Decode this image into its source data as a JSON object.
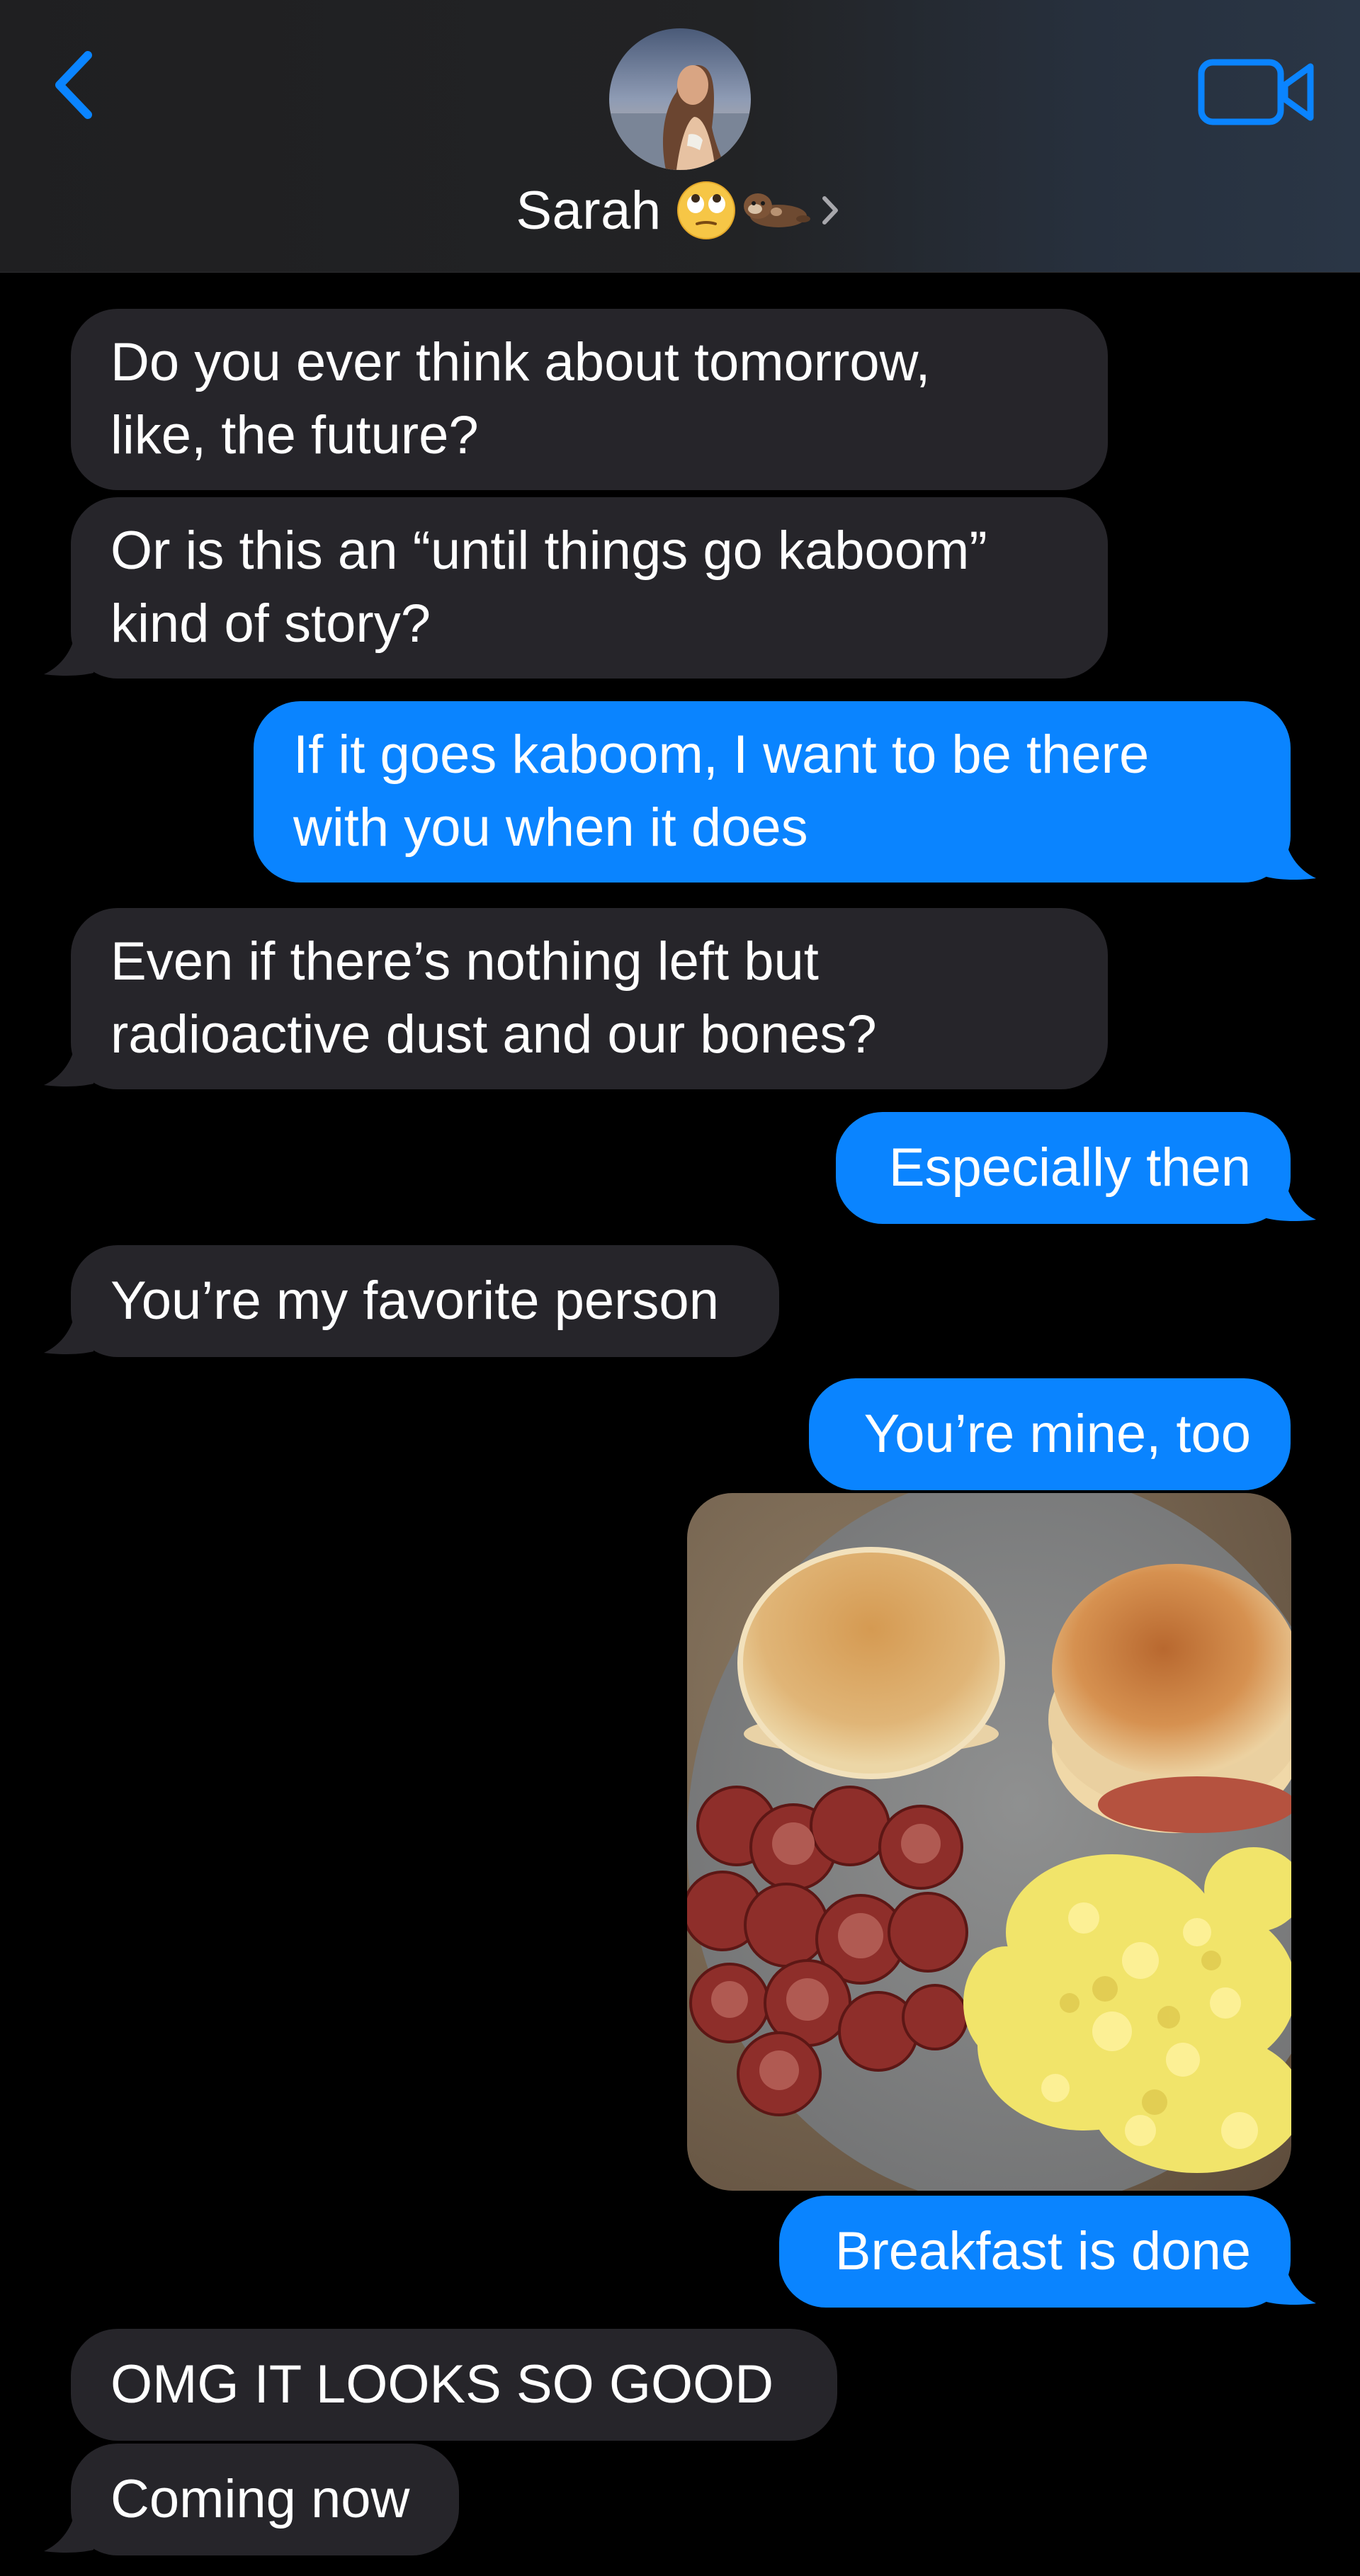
{
  "header": {
    "contact_name": "Sarah",
    "icons": {
      "back": "chevron-left-icon",
      "video": "video-camera-icon",
      "emoji1": "face-with-rolling-eyes-icon",
      "emoji2": "otter-icon",
      "disclosure": "chevron-right-icon"
    }
  },
  "colors": {
    "incoming_bubble": "#26252a",
    "outgoing_bubble": "#0a84ff",
    "accent": "#0a84ff",
    "background": "#000000"
  },
  "messages": [
    {
      "from": "them",
      "text": "Do you ever think about tomorrow,\nlike, the future?"
    },
    {
      "from": "them",
      "text": "Or is this an “until things go kaboom”\nkind of story?"
    },
    {
      "from": "me",
      "text": "If it goes kaboom, I want to be there\nwith you when it does"
    },
    {
      "from": "them",
      "text": "Even if there’s nothing left but\nradioactive dust and our bones?"
    },
    {
      "from": "me",
      "text": "Especially then"
    },
    {
      "from": "them",
      "text": "You’re my favorite person"
    },
    {
      "from": "me",
      "text": "You’re mine, too"
    },
    {
      "from": "me",
      "type": "photo",
      "subject": "breakfast-plate-photo"
    },
    {
      "from": "me",
      "text": "Breakfast is done"
    },
    {
      "from": "them",
      "text": "OMG IT LOOKS SO GOOD"
    },
    {
      "from": "them",
      "text": "Coming now"
    }
  ]
}
